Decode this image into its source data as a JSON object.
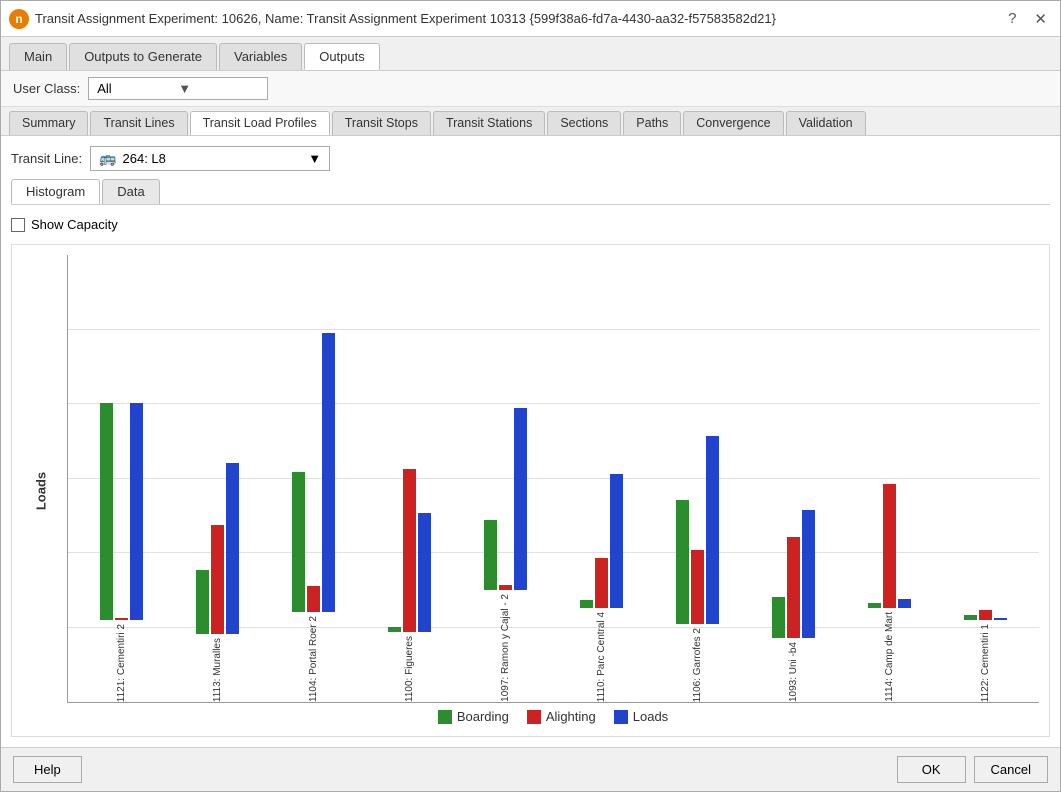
{
  "window": {
    "title": "Transit Assignment Experiment: 10626, Name: Transit Assignment Experiment 10313  {599f38a6-fd7a-4430-aa32-f57583582d21}",
    "help_btn": "?",
    "close_btn": "✕"
  },
  "top_tabs": [
    {
      "label": "Main",
      "active": false
    },
    {
      "label": "Outputs to Generate",
      "active": false
    },
    {
      "label": "Variables",
      "active": false
    },
    {
      "label": "Outputs",
      "active": true
    }
  ],
  "user_class": {
    "label": "User Class:",
    "value": "All"
  },
  "sub_tabs": [
    {
      "label": "Summary",
      "active": false
    },
    {
      "label": "Transit Lines",
      "active": false
    },
    {
      "label": "Transit Load Profiles",
      "active": true
    },
    {
      "label": "Transit Stops",
      "active": false
    },
    {
      "label": "Transit Stations",
      "active": false
    },
    {
      "label": "Sections",
      "active": false
    },
    {
      "label": "Paths",
      "active": false
    },
    {
      "label": "Convergence",
      "active": false
    },
    {
      "label": "Validation",
      "active": false
    }
  ],
  "transit_line": {
    "label": "Transit Line:",
    "value": "264: L8"
  },
  "inner_tabs": [
    {
      "label": "Histogram",
      "active": true
    },
    {
      "label": "Data",
      "active": false
    }
  ],
  "show_capacity": {
    "label": "Show Capacity",
    "checked": false
  },
  "chart": {
    "y_label": "Loads",
    "y_ticks": [
      "0",
      "50",
      "100",
      "150",
      "200",
      "250",
      "300"
    ],
    "y_max": 300,
    "stops": [
      {
        "name": "1121: Cementiri 2",
        "boarding": 210,
        "alighting": 2,
        "loads": 210
      },
      {
        "name": "1113: Muralles",
        "boarding": 62,
        "alighting": 105,
        "loads": 165
      },
      {
        "name": "1104: Portal Roer 2",
        "boarding": 135,
        "alighting": 25,
        "loads": 270
      },
      {
        "name": "1100: Figueres",
        "boarding": 5,
        "alighting": 158,
        "loads": 115
      },
      {
        "name": "1097: Ramon y Cajal - 2",
        "boarding": 68,
        "alighting": 5,
        "loads": 176
      },
      {
        "name": "1110: Parc Central 4",
        "boarding": 8,
        "alighting": 48,
        "loads": 130
      },
      {
        "name": "1106: Garrofes 2",
        "boarding": 120,
        "alighting": 72,
        "loads": 182
      },
      {
        "name": "1093: Uni -b4",
        "boarding": 40,
        "alighting": 98,
        "loads": 124
      },
      {
        "name": "1114: Camp de Mart",
        "boarding": 5,
        "alighting": 120,
        "loads": 9
      },
      {
        "name": "1122: Cementiri 1",
        "boarding": 5,
        "alighting": 10,
        "loads": 2
      }
    ]
  },
  "legend": {
    "items": [
      {
        "label": "Boarding",
        "color": "#2d8c2d"
      },
      {
        "label": "Alighting",
        "color": "#cc2222"
      },
      {
        "label": "Loads",
        "color": "#2244cc"
      }
    ]
  },
  "buttons": {
    "help": "Help",
    "ok": "OK",
    "cancel": "Cancel"
  }
}
